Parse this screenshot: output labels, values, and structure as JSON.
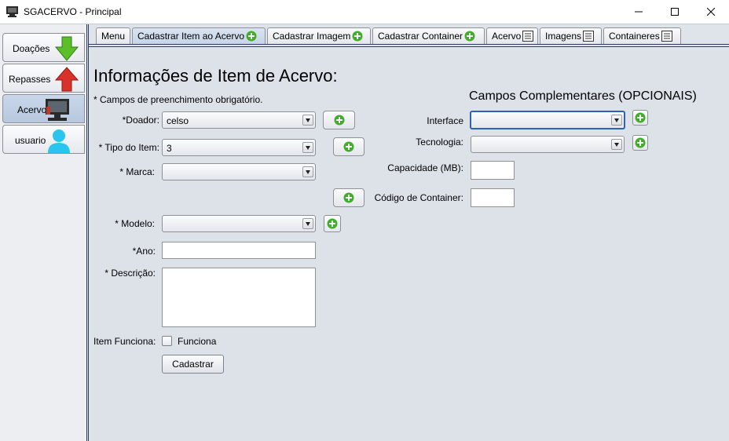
{
  "window": {
    "title": "SGACERVO - Principal"
  },
  "sidebar": {
    "items": [
      {
        "label": "Doações",
        "icon": "arrow-down-green-icon"
      },
      {
        "label": "Repasses",
        "icon": "arrow-up-red-icon"
      },
      {
        "label": "Acervo",
        "icon": "computer-icon",
        "selected": true
      },
      {
        "label": "usuario",
        "icon": "user-icon"
      }
    ]
  },
  "tabs": [
    {
      "label": "Menu",
      "icon": null
    },
    {
      "label": "Cadastrar Item ao Acervo",
      "icon": "add-icon",
      "selected": true
    },
    {
      "label": "Cadastrar Imagem",
      "icon": "add-icon"
    },
    {
      "label": "Cadastrar Container",
      "icon": "add-icon"
    },
    {
      "label": "Acervo",
      "icon": "list-icon"
    },
    {
      "label": "Imagens",
      "icon": "list-icon"
    },
    {
      "label": "Containeres",
      "icon": "list-icon"
    }
  ],
  "form": {
    "heading": "Informações de Item de Acervo:",
    "required_note": "* Campos de preenchimento obrigatório.",
    "doador_label": "*Doador:",
    "doador_value": "celso",
    "tipo_label": "* Tipo do Item:",
    "tipo_value": "3",
    "marca_label": "* Marca:",
    "marca_value": "",
    "modelo_label": "* Modelo:",
    "modelo_value": "",
    "ano_label": "*Ano:",
    "ano_value": "",
    "descricao_label": "* Descrição:",
    "descricao_value": "",
    "funciona_label": "Item Funciona:",
    "funciona_checkbox_label": "Funciona",
    "funciona_checked": false,
    "submit_label": "Cadastrar"
  },
  "complementary": {
    "heading": "Campos Complementares (OPCIONAIS)",
    "interface_label": "Interface",
    "interface_value": "",
    "tecnologia_label": "Tecnologia:",
    "tecnologia_value": "",
    "capacidade_label": "Capacidade (MB):",
    "capacidade_value": "",
    "container_label": "Código de Container:",
    "container_value": ""
  },
  "colors": {
    "accent_green": "#3fae29",
    "focus_blue": "#2f62b3",
    "selected_tab": "#c7d5e8"
  }
}
